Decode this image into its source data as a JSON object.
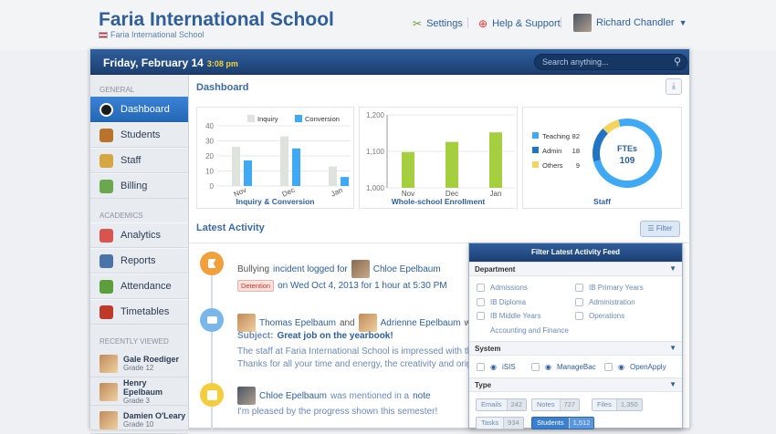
{
  "header": {
    "school": "Faria International School",
    "subschool": "Faria International School",
    "settings": "Settings",
    "help": "Help & Support",
    "user": "Richard Chandler"
  },
  "bar": {
    "date": "Friday, February 14",
    "time": "3:08 pm",
    "search_placeholder": "Search anything..."
  },
  "sidebar": {
    "general_label": "GENERAL",
    "general": [
      {
        "label": "Dashboard",
        "color": "#1b1b1b"
      },
      {
        "label": "Students",
        "color": "#b9732b"
      },
      {
        "label": "Staff",
        "color": "#d6a640"
      },
      {
        "label": "Billing",
        "color": "#6aa84f"
      }
    ],
    "academics_label": "ACADEMICS",
    "academics": [
      {
        "label": "Analytics",
        "color": "#d9534f"
      },
      {
        "label": "Reports",
        "color": "#4a74a8"
      },
      {
        "label": "Attendance",
        "color": "#5b9e3c"
      },
      {
        "label": "Timetables",
        "color": "#c0392b"
      }
    ],
    "recent_label": "RECENTLY VIEWED",
    "recent": [
      {
        "name": "Gale Roediger",
        "grade": "Grade 12"
      },
      {
        "name": "Henry Epelbaum",
        "grade": "Grade 3"
      },
      {
        "name": "Damien O'Leary",
        "grade": "Grade 10"
      }
    ]
  },
  "main": {
    "title": "Dashboard",
    "latest": "Latest Activity",
    "filter_button": "Filter"
  },
  "chart_data": [
    {
      "type": "bar",
      "title": "Inquiry & Conversion",
      "categories": [
        "Nov",
        "Dec",
        "Jan"
      ],
      "series": [
        {
          "name": "Inquiry",
          "values": [
            26,
            33,
            13
          ],
          "color": "#dfe3de"
        },
        {
          "name": "Conversion",
          "values": [
            17,
            25,
            6
          ],
          "color": "#3fa9f5"
        }
      ],
      "ylim": [
        0,
        40
      ],
      "yticks": [
        0,
        10,
        20,
        30,
        40
      ]
    },
    {
      "type": "bar",
      "title": "Whole-school Enrollment",
      "categories": [
        "Nov",
        "Dec",
        "Jan"
      ],
      "values": [
        1098,
        1126,
        1152
      ],
      "color": "#a6cf3f",
      "ylim": [
        1000,
        1200
      ],
      "yticks": [
        "1,000",
        "1,100",
        "1,200"
      ]
    },
    {
      "type": "pie",
      "title": "Staff",
      "center_label": "FTEs",
      "center_value": "109",
      "slices": [
        {
          "name": "Teaching",
          "value": 82,
          "color": "#3fa9f5"
        },
        {
          "name": "Admin",
          "value": 18,
          "color": "#2173c4"
        },
        {
          "name": "Others",
          "value": 9,
          "color": "#f4d35e"
        }
      ]
    }
  ],
  "activity": [
    {
      "lead": "Bullying",
      "mid": "incident logged for",
      "person": "Chloe Epelbaum",
      "badge": "Detention",
      "detail": "on Wed Oct 4, 2013 for 1 hour at 5:30 PM",
      "color": "#f0a03c"
    },
    {
      "p1": "Thomas Epelbaum",
      "and": "and",
      "p2": "Adrienne Epelbaum",
      "verb": "were",
      "subject_label": "Subject:",
      "subject": "Great job on the yearbook!",
      "body1": "The staff at Faria International School is impressed with the",
      "body2": "Thanks for all your time and energy, the creativity and origi",
      "color": "#79b7ea"
    },
    {
      "person": "Chloe Epelbaum",
      "mid": "was mentioned in a",
      "link": "note",
      "body": "I'm pleased by the progress shown this semester!",
      "color": "#f4cd3c"
    }
  ],
  "filter": {
    "title": "Filter Latest Activity Feed",
    "department_label": "Department",
    "departments": [
      "Admissions",
      "IB Primary Years",
      "IB Diploma",
      "Administration",
      "IB Middle Years",
      "Operations",
      "Accounting and Finance"
    ],
    "system_label": "System",
    "systems": [
      "iSIS",
      "ManageBac",
      "OpenApply"
    ],
    "type_label": "Type",
    "types": [
      {
        "label": "Emails",
        "count": "242"
      },
      {
        "label": "Notes",
        "count": "727"
      },
      {
        "label": "Files",
        "count": "1,350"
      },
      {
        "label": "Tasks",
        "count": "934"
      },
      {
        "label": "Students",
        "count": "1,512"
      }
    ]
  }
}
